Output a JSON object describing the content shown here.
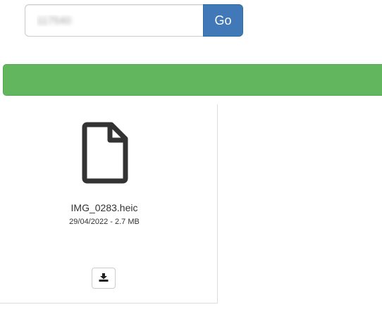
{
  "search": {
    "value": "117540",
    "button_label": "Go"
  },
  "status_bar": {
    "color": "#62b75e"
  },
  "file": {
    "icon": "file-icon",
    "name": "IMG_0283.heic",
    "meta": "29/04/2022 - 2.7 MB",
    "download_icon": "download-icon"
  },
  "colors": {
    "accent": "#4178b8",
    "success": "#62b75e"
  }
}
